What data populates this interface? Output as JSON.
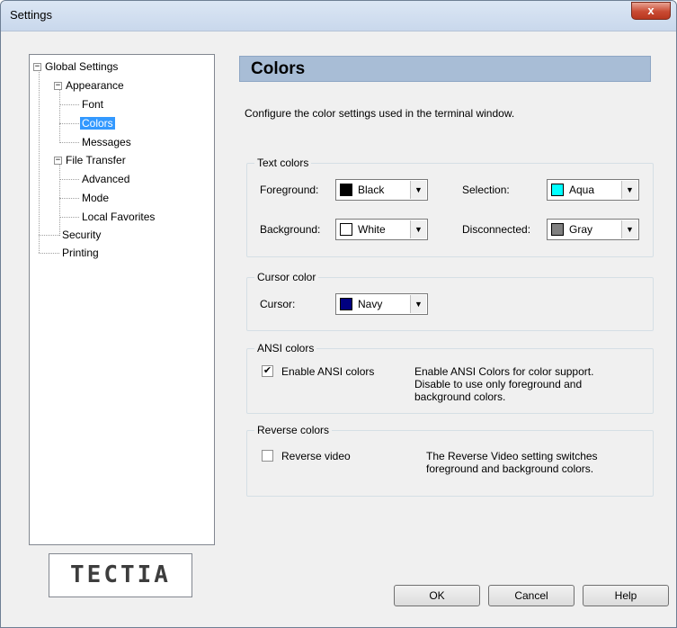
{
  "window": {
    "title": "Settings",
    "close_label": "x"
  },
  "tree": {
    "root": "Global Settings",
    "appearance": "Appearance",
    "font": "Font",
    "colors": "Colors",
    "messages": "Messages",
    "file_transfer": "File Transfer",
    "advanced": "Advanced",
    "mode": "Mode",
    "local_favorites": "Local Favorites",
    "security": "Security",
    "printing": "Printing"
  },
  "logo": {
    "text": "TECTIA"
  },
  "page": {
    "title": "Colors",
    "description": "Configure the color settings used in the terminal window."
  },
  "text_colors": {
    "title": "Text colors",
    "foreground_label": "Foreground:",
    "foreground_value": "Black",
    "foreground_color": "#000000",
    "background_label": "Background:",
    "background_value": "White",
    "background_color": "#ffffff",
    "selection_label": "Selection:",
    "selection_value": "Aqua",
    "selection_color": "#00ffff",
    "disconnected_label": "Disconnected:",
    "disconnected_value": "Gray",
    "disconnected_color": "#808080"
  },
  "cursor_color": {
    "title": "Cursor color",
    "cursor_label": "Cursor:",
    "cursor_value": "Navy",
    "cursor_color": "#000080"
  },
  "ansi_colors": {
    "title": "ANSI colors",
    "checkbox_label": "Enable ANSI colors",
    "checked": true,
    "desc_line1": "Enable ANSI Colors for color support.",
    "desc_line2": "Disable to use only foreground and",
    "desc_line3": "background colors."
  },
  "reverse_colors": {
    "title": "Reverse colors",
    "checkbox_label": "Reverse video",
    "checked": false,
    "desc_line1": "The Reverse Video setting switches",
    "desc_line2": "foreground and background colors."
  },
  "buttons": {
    "ok": "OK",
    "cancel": "Cancel",
    "help": "Help"
  },
  "glyphs": {
    "dropdown": "▼",
    "check": "✔",
    "collapse": "−"
  },
  "accent": "#3399ff"
}
